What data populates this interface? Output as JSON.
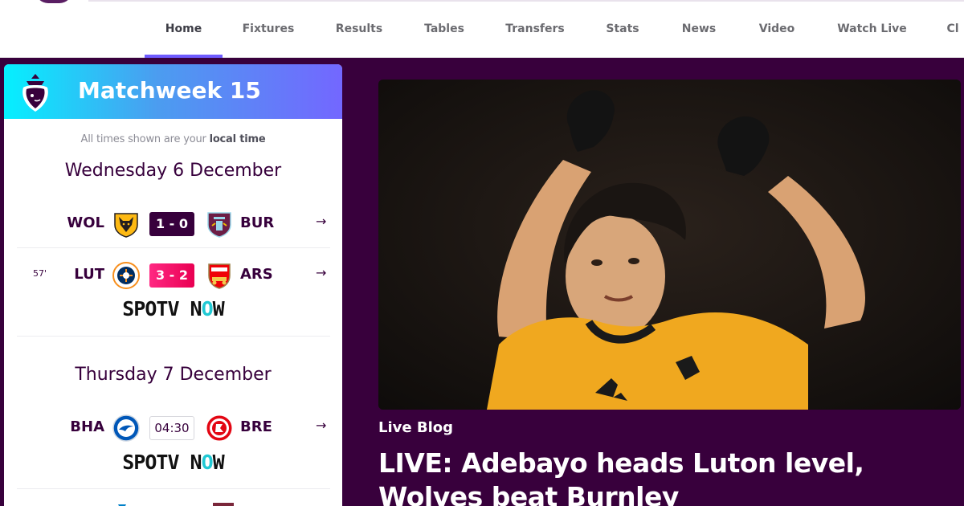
{
  "nav": {
    "items": [
      {
        "label": "Home",
        "active": true
      },
      {
        "label": "Fixtures"
      },
      {
        "label": "Results"
      },
      {
        "label": "Tables"
      },
      {
        "label": "Transfers"
      },
      {
        "label": "Stats"
      },
      {
        "label": "News"
      },
      {
        "label": "Video"
      },
      {
        "label": "Watch Live"
      },
      {
        "label": "Cl"
      }
    ]
  },
  "matchweek": {
    "title": "Matchweek 15",
    "times_note_prefix": "All times shown are your ",
    "times_note_bold": "local time",
    "days": [
      {
        "date": "Wednesday 6 December",
        "matches": [
          {
            "home": "WOL",
            "away": "BUR",
            "score": "1 - 0",
            "state": "ft",
            "minute": "",
            "home_badge": "wolves-badge-icon",
            "away_badge": "burnley-badge-icon",
            "broadcaster": ""
          },
          {
            "home": "LUT",
            "away": "ARS",
            "score": "3 - 2",
            "state": "live",
            "minute": "57'",
            "home_badge": "luton-badge-icon",
            "away_badge": "arsenal-badge-icon",
            "broadcaster": "SPOTV NOW"
          }
        ]
      },
      {
        "date": "Thursday 7 December",
        "matches": [
          {
            "home": "BHA",
            "away": "BRE",
            "score": "04:30",
            "state": "kickoff",
            "minute": "",
            "home_badge": "brighton-badge-icon",
            "away_badge": "brentford-badge-icon",
            "broadcaster": "SPOTV NOW"
          }
        ]
      }
    ],
    "broadcaster_parts": {
      "a": "SPOTV N",
      "b": "O",
      "c": "W"
    }
  },
  "feature": {
    "tag": "Live Blog",
    "headline": "LIVE: Adebayo heads Luton level, Wolves beat Burnley",
    "colors": {
      "shirt": "#f0a81f",
      "accent": "#37003c"
    }
  },
  "icons": {
    "arrow": "→"
  }
}
